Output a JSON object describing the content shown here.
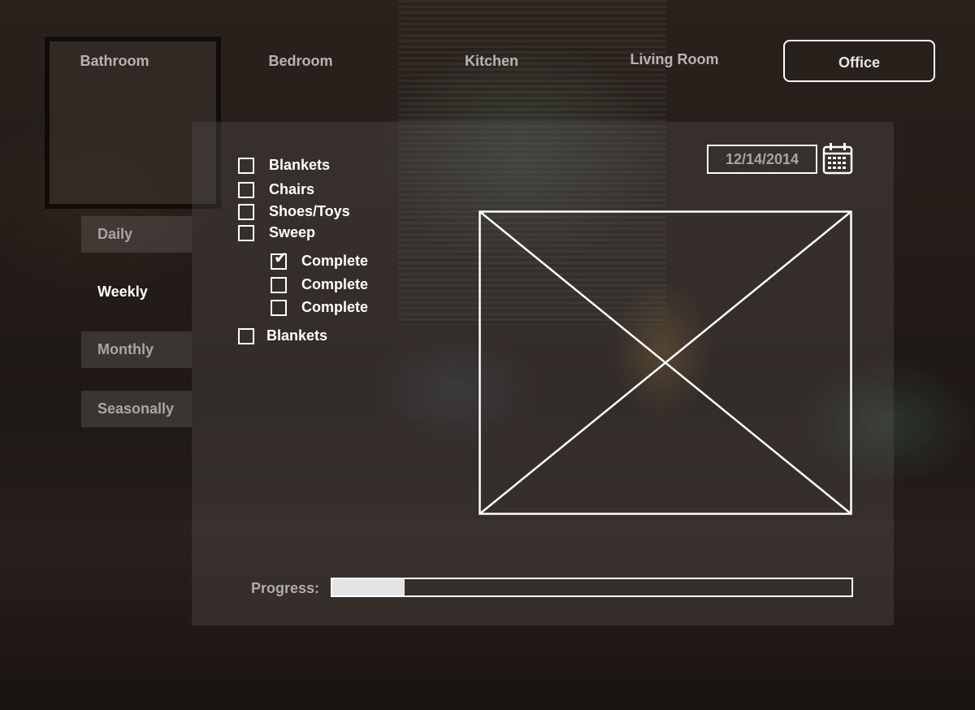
{
  "rooms": [
    {
      "label": "Bathroom",
      "active": false
    },
    {
      "label": "Bedroom",
      "active": false
    },
    {
      "label": "Kitchen",
      "active": false
    },
    {
      "label": "Living Room",
      "active": false
    },
    {
      "label": "Office",
      "active": true
    }
  ],
  "frequency_tabs": [
    {
      "label": "Daily",
      "active": false
    },
    {
      "label": "Weekly",
      "active": true
    },
    {
      "label": "Monthly",
      "active": false
    },
    {
      "label": "Seasonally",
      "active": false
    }
  ],
  "checklist": [
    {
      "label": "Blankets",
      "checked": false
    },
    {
      "label": "Chairs",
      "checked": false
    },
    {
      "label": "Shoes/Toys",
      "checked": false
    },
    {
      "label": "Sweep",
      "checked": false
    },
    {
      "label": "Complete",
      "checked": true
    },
    {
      "label": "Complete",
      "checked": false
    },
    {
      "label": "Complete",
      "checked": false
    },
    {
      "label": "Blankets",
      "checked": false
    }
  ],
  "date": {
    "value": "12/14/2014",
    "icon": "calendar-icon"
  },
  "image_placeholder": {
    "icon": "image-placeholder-icon"
  },
  "progress": {
    "label": "Progress:",
    "fraction": 0.14
  }
}
